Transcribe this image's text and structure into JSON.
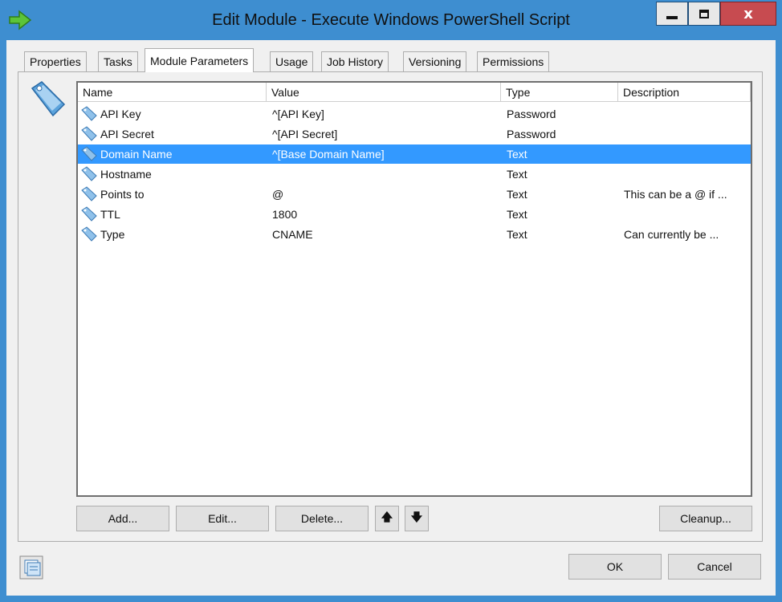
{
  "window": {
    "title": "Edit Module - Execute Windows PowerShell Script",
    "close_glyph": "x"
  },
  "tabs": [
    {
      "label": "Properties"
    },
    {
      "label": "Tasks"
    },
    {
      "label": "Module Parameters",
      "active": true
    },
    {
      "label": "Usage"
    },
    {
      "label": "Job History"
    },
    {
      "label": "Versioning"
    },
    {
      "label": "Permissions"
    }
  ],
  "columns": [
    "Name",
    "Value",
    "Type",
    "Description"
  ],
  "rows": [
    {
      "name": "API Key",
      "value": "^[API Key]",
      "type": "Password",
      "description": ""
    },
    {
      "name": "API Secret",
      "value": "^[API Secret]",
      "type": "Password",
      "description": ""
    },
    {
      "name": "Domain Name",
      "value": "^[Base Domain Name]",
      "type": "Text",
      "description": "",
      "selected": true
    },
    {
      "name": "Hostname",
      "value": "",
      "type": "Text",
      "description": ""
    },
    {
      "name": "Points to",
      "value": "@",
      "type": "Text",
      "description": "This can be a @ if ..."
    },
    {
      "name": "TTL",
      "value": "1800",
      "type": "Text",
      "description": ""
    },
    {
      "name": "Type",
      "value": "CNAME",
      "type": "Text",
      "description": "Can currently be ..."
    }
  ],
  "buttons": {
    "add": "Add...",
    "edit": "Edit...",
    "delete": "Delete...",
    "move_up": "🡅",
    "move_down": "🡇",
    "cleanup": "Cleanup...",
    "ok": "OK",
    "cancel": "Cancel"
  },
  "icons": {
    "app": "green-arrow-icon",
    "parameters": "tag-icon",
    "row": "tag-icon",
    "footer": "module-icon"
  },
  "colors": {
    "frame": "#3e8ed0",
    "selection": "#3399ff",
    "close_button": "#c74b50"
  }
}
